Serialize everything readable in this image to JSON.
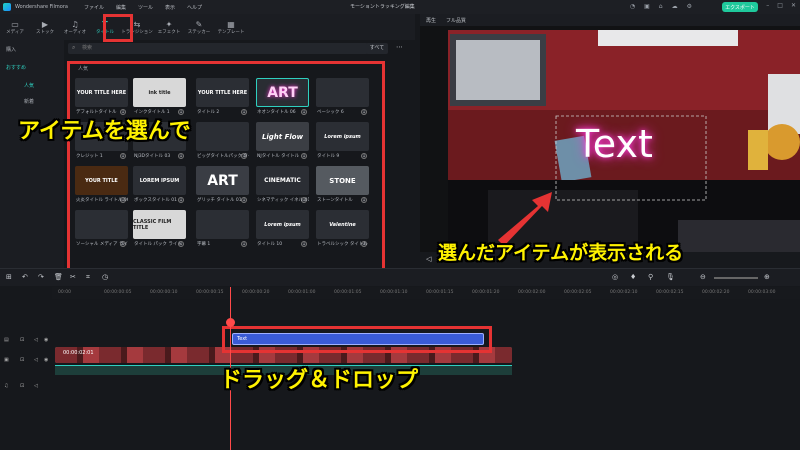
{
  "app": {
    "name": "Wondershare Filmora",
    "menus": [
      "ファイル",
      "編集",
      "ツール",
      "表示",
      "ヘルプ"
    ],
    "window_title": "モーショントラッキング編集",
    "export_label": "エクスポート"
  },
  "toolbar": {
    "tabs": [
      "メディア",
      "ストック",
      "オーディオ",
      "タイトル",
      "トランジション",
      "エフェクト",
      "ステッカー",
      "テンプレート"
    ],
    "active_tab": 3
  },
  "sidebar": {
    "items": [
      "購入",
      "おすすめ",
      "人気",
      "新着"
    ]
  },
  "search": {
    "placeholder": "検索",
    "filter_label": "すべて"
  },
  "library": {
    "section_title": "人気",
    "cards": [
      {
        "thumb": "YOUR TITLE HERE",
        "label": "デフォルトタイトル"
      },
      {
        "thumb": "ink title",
        "label": "インクタイトル 1"
      },
      {
        "thumb": "YOUR TITLE HERE",
        "label": "タイトル 2"
      },
      {
        "thumb": "ART",
        "label": "ネオンタイトル 06"
      },
      {
        "thumb": "",
        "label": "ベーシック 6"
      },
      {
        "thumb": "",
        "label": "クレジット 1"
      },
      {
        "thumb": "",
        "label": "NJ3Dタイトル 03"
      },
      {
        "thumb": "",
        "label": "ビッグタイトルパック タイトル"
      },
      {
        "thumb": "Light Flow",
        "label": "NJタイトル タイトル"
      },
      {
        "thumb": "Lorem ipsum",
        "label": "タイトル 9"
      },
      {
        "thumb": "YOUR TITLE",
        "label": "火炎タイトル ライトル 06"
      },
      {
        "thumb": "LOREM IPSUM",
        "label": "ボックスタイトル 01"
      },
      {
        "thumb": "ART",
        "label": "グリッチ タイトル 01"
      },
      {
        "thumb": "CINEMATIC",
        "label": "シネマティック イネル 01"
      },
      {
        "thumb": "STONE",
        "label": "ストーンタイトル"
      },
      {
        "thumb": "",
        "label": "ソーシャル メディア ライトル"
      },
      {
        "thumb": "CLASSIC FILM TITLE",
        "label": "タイトル パック ライト"
      },
      {
        "thumb": "",
        "label": "字幕 1"
      },
      {
        "thumb": "Lorem ipsum",
        "label": "タイトル 10"
      },
      {
        "thumb": "Valentine",
        "label": "トラベルシック タイトル"
      }
    ]
  },
  "preview": {
    "tabs": [
      "再生",
      "フル品質"
    ],
    "overlay_text": "Text"
  },
  "timeline": {
    "ruler_ticks": [
      "00:00",
      "00:00:00:05",
      "00:00:00:10",
      "00:00:00:15",
      "00:00:00:20",
      "00:00:01:00",
      "00:00:01:05",
      "00:00:01:10",
      "00:00:01:15",
      "00:00:01:20",
      "00:00:02:00",
      "00:00:02:05",
      "00:00:02:10",
      "00:00:02:15",
      "00:00:02:20",
      "00:00:03:00"
    ],
    "text_clip_label": "Text",
    "video_clip_label": "00:00:02:01"
  },
  "annotations": {
    "callout_left": "アイテムを選んで",
    "callout_right": "選んだアイテムが表示される",
    "callout_bottom": "ドラッグ＆ドロップ"
  },
  "colors": {
    "accent": "#2fd0c0",
    "highlight": "#e53333",
    "callout_text": "#fff200",
    "text_clip": "#3a5bd6",
    "video_track": "#2b8a80"
  }
}
